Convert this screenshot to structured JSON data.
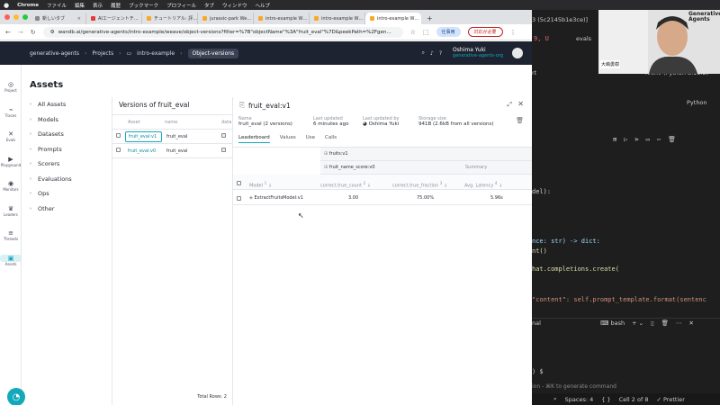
{
  "menubar": {
    "app": "Chrome",
    "items": [
      "ファイル",
      "編集",
      "表示",
      "履歴",
      "ブックマーク",
      "プロフィール",
      "タブ",
      "ウィンドウ",
      "ヘルプ"
    ]
  },
  "browser": {
    "tabs": [
      "新しいタブ",
      "AIエージェントチ…",
      "チュートリアル: 評…",
      "jurassic-park We…",
      "intro-example W…",
      "intro-example W…",
      "intro-example W…"
    ],
    "url": "wandb.ai/generative-agents/intro-example/weave/object-versions?filter=%7B\"objectName\"%3A\"fruit_eval\"%7D&peekPath=%2Fgen…",
    "pill_work": "仕事用",
    "pill_action": "対応が必要"
  },
  "header": {
    "org": "generative-agents",
    "projects": "Projects",
    "project": "intro-example",
    "page": "Object-versions",
    "user_name": "Oshima Yuki",
    "user_org": "generative-agents-org"
  },
  "rail": [
    {
      "icon": "project-icon",
      "glyph": "◎",
      "label": "Project"
    },
    {
      "icon": "traces-icon",
      "glyph": "⌁",
      "label": "Traces"
    },
    {
      "icon": "evals-icon",
      "glyph": "✕",
      "label": "Evals"
    },
    {
      "icon": "playground-icon",
      "glyph": "▶",
      "label": "Playground"
    },
    {
      "icon": "monitors-icon",
      "glyph": "◉",
      "label": "Monitors"
    },
    {
      "icon": "leaders-icon",
      "glyph": "♛",
      "label": "Leaders"
    },
    {
      "icon": "threads-icon",
      "glyph": "≡",
      "label": "Threads"
    },
    {
      "icon": "assets-icon",
      "glyph": "▣",
      "label": "Assets"
    }
  ],
  "assets": {
    "title": "Assets",
    "nav": [
      "All Assets",
      "Models",
      "Datasets",
      "Prompts",
      "Scorers",
      "Evaluations",
      "Ops",
      "Other"
    ]
  },
  "versions": {
    "title": "Versions of fruit_eval",
    "headers": [
      "Asset",
      "name",
      "data"
    ],
    "rows": [
      {
        "asset": "fruit_eval:v1",
        "name": "fruit_eval"
      },
      {
        "asset": "fruit_eval:v0",
        "name": "fruit_eval"
      }
    ],
    "total": "Total Rows: 2"
  },
  "detail": {
    "title": "fruit_eval:v1",
    "name_label": "Name",
    "name_value": "fruit_eval (2 versions)",
    "updated_label": "Last updated",
    "updated_value": "6 minutes ago",
    "by_label": "Last updated by",
    "by_value": "Oshima Yuki",
    "storage_label": "Storage size",
    "storage_value": "941B (2.6kB from all versions)",
    "tabs": [
      "Leaderboard",
      "Values",
      "Use",
      "Calls"
    ],
    "group1": "fruits:v1",
    "group2": "fruit_name_score:v0",
    "summary": "Summary",
    "cols": [
      "Model",
      "correct.true_count",
      "correct.true_fraction",
      "Avg. Latency"
    ],
    "col_nums": [
      "1",
      "2",
      "3",
      "4"
    ],
    "row": {
      "model": "ExtractFruitsModel:v1",
      "count": "3.00",
      "fraction": "75.00%",
      "latency": "5.96s"
    }
  },
  "editor": {
    "tab_hash": "3 (5c2145b1e3ce)]",
    "evals": "evals",
    "kernel": ".venv (Python 3.11.2)",
    "python": "Python",
    "ln_frag": "9, U",
    "rt": "rt",
    "lines": [
      "del):",
      "nce: str) -> dict:",
      "nt()",
      "hat.completions.create(",
      "\"content\": self.prompt_template.format(sentenc"
    ],
    "terminal_tab": "nal",
    "bash": "bash",
    "prompt": ") $",
    "hint": "ion - ⌘K to generate command",
    "status": [
      "Spaces: 4",
      "{ }",
      "Cell 2 of 8",
      "✓ Prettier"
    ]
  },
  "webcam": {
    "label": "大嶋勇樹",
    "logo": "Generative Agents",
    "badge": "仕事用"
  }
}
